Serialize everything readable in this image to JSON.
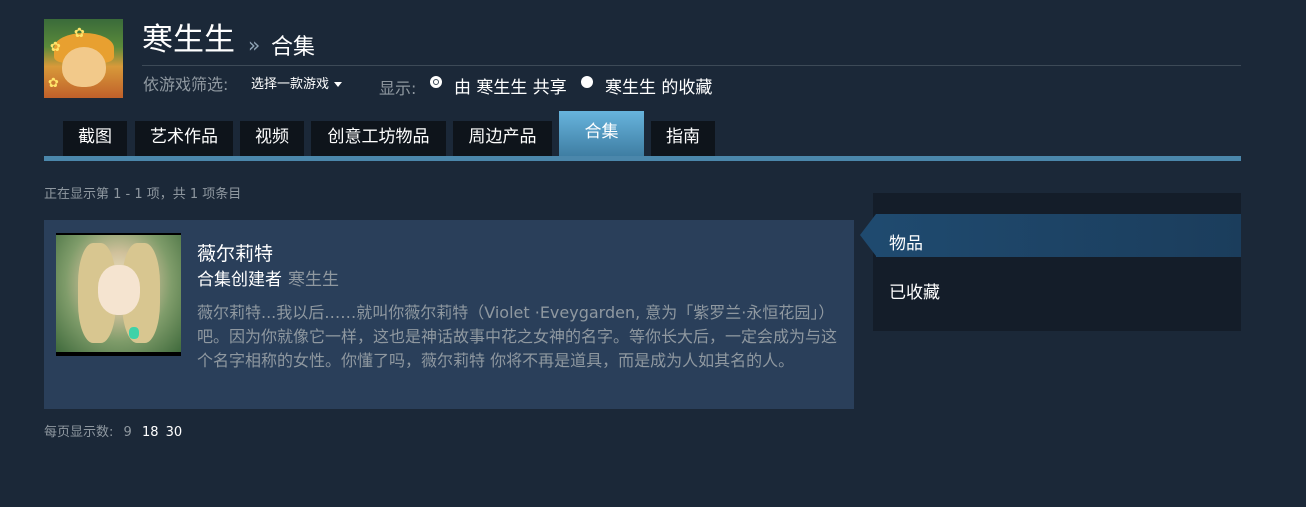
{
  "profile": {
    "username": "寒生生",
    "breadcrumb_sep": "»",
    "section": "合集"
  },
  "filter": {
    "label": "依游戏筛选:",
    "select_value": "选择一款游戏"
  },
  "display": {
    "label": "显示:",
    "options": [
      {
        "label": "由 寒生生 共享",
        "checked": true
      },
      {
        "label": "寒生生 的收藏",
        "checked": false
      }
    ]
  },
  "tabs": [
    {
      "label": "截图",
      "active": false
    },
    {
      "label": "艺术作品",
      "active": false
    },
    {
      "label": "视频",
      "active": false
    },
    {
      "label": "创意工坊物品",
      "active": false
    },
    {
      "label": "周边产品",
      "active": false
    },
    {
      "label": "合集",
      "active": true
    },
    {
      "label": "指南",
      "active": false
    }
  ],
  "count_text": "正在显示第 1 - 1 项，共 1 项条目",
  "collection": {
    "title": "薇尔莉特",
    "creator_prefix": "合集创建者",
    "creator_name": "寒生生",
    "description": "薇尔莉特...我以后……就叫你薇尔莉特（Violet ·Eveygarden, 意为「紫罗兰·永恒花园」）吧。因为你就像它一样，这也是神话故事中花之女神的名字。等你长大后，一定会成为与这个名字相称的女性。你懂了吗，薇尔莉特 你将不再是道具，而是成为人如其名的人。"
  },
  "per_page": {
    "label": "每页显示数:",
    "options": [
      "9",
      "18",
      "30"
    ],
    "current": "9"
  },
  "side_menu": {
    "items": [
      {
        "label": "物品",
        "active": true
      },
      {
        "label": "已收藏",
        "active": false
      }
    ]
  },
  "colors": {
    "background": "#1b2838",
    "tab_active": "#4b87ab",
    "card": "#2a3f5a",
    "muted_text": "#8f98a0"
  }
}
